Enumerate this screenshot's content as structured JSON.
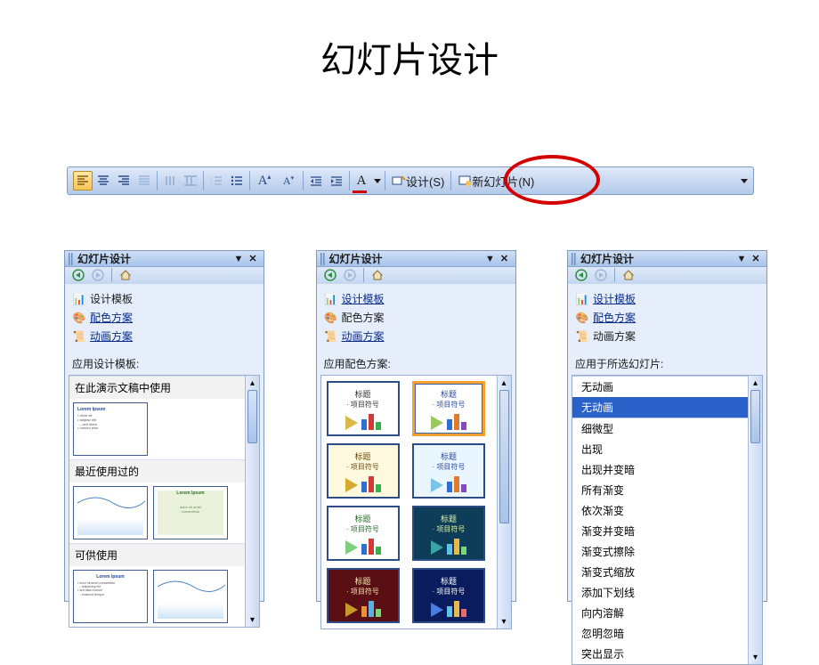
{
  "title": "幻灯片设计",
  "toolbar": {
    "design_label": "设计(S)",
    "newslide_label": "新幻灯片(N)"
  },
  "panel_titles": {
    "p1": "幻灯片设计",
    "p2": "幻灯片设计",
    "p3": "幻灯片设计"
  },
  "links": {
    "design_template": "设计模板",
    "color_scheme": "配色方案",
    "anim_scheme": "动画方案"
  },
  "p1": {
    "section": "应用设计模板:",
    "sub1": "在此演示文稿中使用",
    "sub2": "最近使用过的",
    "sub3": "可供使用"
  },
  "p2": {
    "section": "应用配色方案:",
    "thumb_title": "标题",
    "thumb_sub": "项目符号"
  },
  "p3": {
    "section": "应用于所选幻灯片:",
    "items": [
      "无动画",
      "无动画",
      "细微型",
      "出现",
      "出现并变暗",
      "所有渐变",
      "依次渐变",
      "渐变并变暗",
      "渐变式擦除",
      "渐变式缩放",
      "添加下划线",
      "向内溶解",
      "忽明忽暗",
      "突出显示"
    ],
    "selected_index": 1
  },
  "scheme_colors": [
    {
      "bg": "#ffffff",
      "fg": "#333333",
      "arrow": "#d9b94a",
      "bars": [
        "#2f6fd1",
        "#d23a3a",
        "#3ab04a"
      ],
      "sel": false
    },
    {
      "bg": "#ffffff",
      "fg": "#2d4aa0",
      "arrow": "#9cc95f",
      "bars": [
        "#2f6fd1",
        "#e07a2e",
        "#8448c2"
      ],
      "sel": true
    },
    {
      "bg": "#fff9e0",
      "fg": "#6b4a10",
      "arrow": "#d6a931",
      "bars": [
        "#2f6fd1",
        "#d23a3a",
        "#3ab04a"
      ],
      "sel": false
    },
    {
      "bg": "#eaf6ff",
      "fg": "#2d4aa0",
      "arrow": "#7cc3e8",
      "bars": [
        "#2f6fd1",
        "#e07a2e",
        "#8448c2"
      ],
      "sel": false
    },
    {
      "bg": "#ffffff",
      "fg": "#2a6b2a",
      "arrow": "#7fce7f",
      "bars": [
        "#2f6fd1",
        "#d23a3a",
        "#3ab04a"
      ],
      "sel": false
    },
    {
      "bg": "#0d3d58",
      "fg": "#dff3a0",
      "arrow": "#3aa3a3",
      "bars": [
        "#62c1e8",
        "#e8b84c",
        "#7ad67a"
      ],
      "sel": false
    },
    {
      "bg": "#5a0f14",
      "fg": "#f6e6b0",
      "arrow": "#c69a2a",
      "bars": [
        "#e8923a",
        "#5ab0e0",
        "#7ad67a"
      ],
      "sel": false
    },
    {
      "bg": "#0a1c5d",
      "fg": "#ffffff",
      "arrow": "#4a7de0",
      "bars": [
        "#62c1e8",
        "#e8b84c",
        "#e86a6a"
      ],
      "sel": false
    }
  ]
}
